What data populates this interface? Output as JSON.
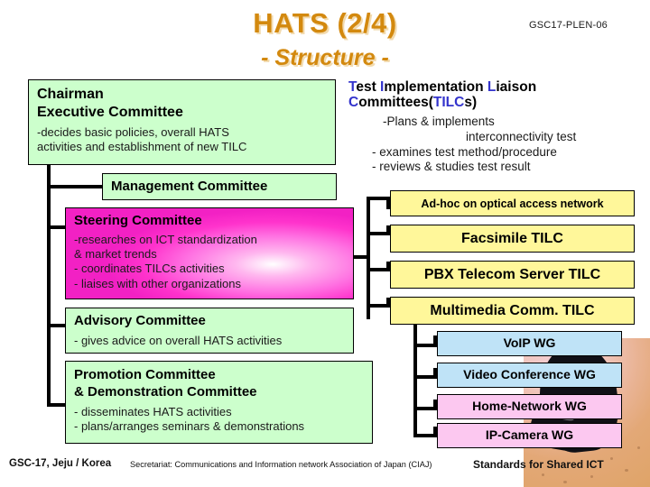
{
  "slide": {
    "title": "HATS (2/4)",
    "subtitle": "- Structure -",
    "doc_code": "GSC17-PLEN-06",
    "title_color": "#D3890F"
  },
  "left_column": {
    "chairman_box": {
      "heading_line1": "Chairman",
      "heading_line2": "Executive Committee",
      "bullet1": "-decides basic policies, overall HATS",
      "bullet2": " activities and establishment of new TILC",
      "color": "#CCFFCC"
    },
    "management_box": {
      "heading": "Management Committee",
      "color": "#CCFFCC"
    },
    "steering_box": {
      "heading": "Steering Committee",
      "bullet1": "-researches on ICT standardization",
      "bullet2": " & market trends",
      "bullet3": "- coordinates TILCs activities",
      "bullet4": "- liaises with other organizations",
      "color": "#FF33CC"
    },
    "advisory_box": {
      "heading": "Advisory Committee",
      "bullet1": "- gives advice on overall HATS activities",
      "color": "#CCFFCC"
    },
    "promotion_box": {
      "heading_line1": "Promotion Committee",
      "heading_line2": " & Demonstration Committee",
      "bullet1": "- disseminates HATS activities",
      "bullet2": "- plans/arranges seminars & demonstrations",
      "color": "#CCFFCC"
    }
  },
  "right_column": {
    "tilc_header": {
      "line1_parts": [
        {
          "text": "T",
          "color": "#3333CC"
        },
        {
          "text": "est ",
          "color": "#000000"
        },
        {
          "text": "I",
          "color": "#3333CC"
        },
        {
          "text": "mplementation ",
          "color": "#000000"
        },
        {
          "text": "L",
          "color": "#3333CC"
        },
        {
          "text": "iaison",
          "color": "#000000"
        }
      ],
      "line2_parts": [
        {
          "text": "C",
          "color": "#3333CC"
        },
        {
          "text": "ommittees(",
          "color": "#000000"
        },
        {
          "text": "TILC",
          "color": "#3333CC"
        },
        {
          "text": "s)",
          "color": "#000000"
        }
      ],
      "bullet1": "-Plans & implements",
      "bullet2": "interconnectivity test",
      "bullet3": "- examines test method/procedure",
      "bullet4": "- reviews & studies test result"
    },
    "tilc_boxes": [
      {
        "label": "Ad-hoc on optical access network",
        "color": "#FFF79A",
        "size": "small"
      },
      {
        "label": "Facsimile TILC",
        "color": "#FFF79A",
        "size": "large"
      },
      {
        "label": "PBX Telecom Server TILC",
        "color": "#FFF79A",
        "size": "large"
      },
      {
        "label": "Multimedia Comm. TILC",
        "color": "#FFF79A",
        "size": "large"
      }
    ],
    "wg_boxes": [
      {
        "label": "VoIP WG",
        "color": "#BFE3F7"
      },
      {
        "label": "Video Conference WG",
        "color": "#BFE3F7"
      },
      {
        "label": "Home-Network WG",
        "color": "#FCC8F0"
      },
      {
        "label": "IP-Camera WG",
        "color": "#FCC8F0"
      }
    ]
  },
  "footer": {
    "left": "GSC-17, Jeju / Korea",
    "middle": "Secretariat: Communications and Information network Association of Japan (CIAJ)",
    "right": "Standards for Shared ICT"
  }
}
